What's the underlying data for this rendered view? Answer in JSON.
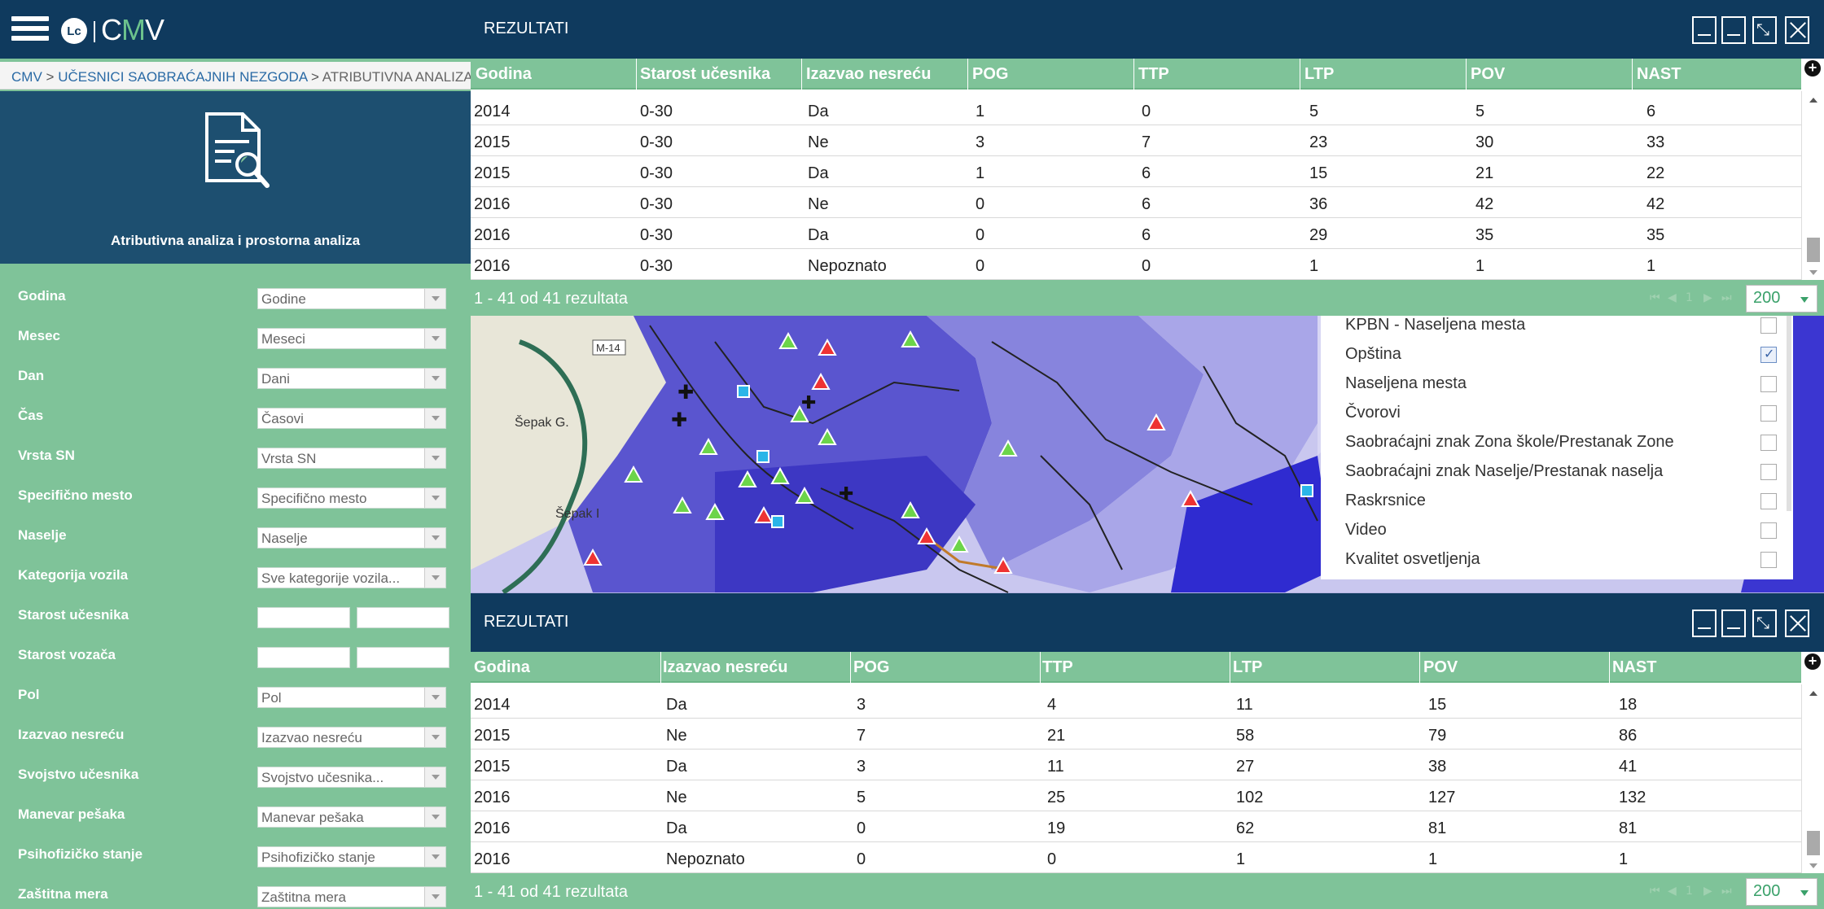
{
  "sidebar": {
    "logo_short": "Lc",
    "logo_text_pre": "C",
    "logo_text_m": "M",
    "logo_text_post": "V",
    "breadcrumb": [
      "CMV",
      "UČESNICI SAOBRAĆAJNIH NEZGODA",
      "ATRIBUTIVNA ANALIZA I P"
    ],
    "breadcrumb_sep": ">",
    "title": "Atributivna analiza i prostorna analiza",
    "filters": [
      {
        "label": "Godina",
        "value": "Godine"
      },
      {
        "label": "Mesec",
        "value": "Meseci"
      },
      {
        "label": "Dan",
        "value": "Dani"
      },
      {
        "label": "Čas",
        "value": "Časovi"
      },
      {
        "label": "Vrsta SN",
        "value": "Vrsta SN"
      },
      {
        "label": "Specifično mesto",
        "value": "Specifično mesto"
      },
      {
        "label": "Naselje",
        "value": "Naselje"
      },
      {
        "label": "Kategorija vozila",
        "value": "Sve kategorije vozila..."
      },
      {
        "label": "Starost učesnika",
        "value": ""
      },
      {
        "label": "Starost vozača",
        "value": ""
      },
      {
        "label": "Pol",
        "value": "Pol"
      },
      {
        "label": "Izazvao nesreću",
        "value": "Izazvao nesreću"
      },
      {
        "label": "Svojstvo učesnika",
        "value": "Svojstvo učesnika..."
      },
      {
        "label": "Manevar pešaka",
        "value": "Manevar pešaka"
      },
      {
        "label": "Psihofizičko stanje",
        "value": "Psihofizičko stanje"
      },
      {
        "label": "Zaštitna mera",
        "value": "Zaštitna mera"
      }
    ]
  },
  "panel1": {
    "title": "REZULTATI",
    "columns": [
      "Godina",
      "Starost učesnika",
      "Izazvao nesreću",
      "POG",
      "TTP",
      "LTP",
      "POV",
      "NAST"
    ],
    "rows": [
      [
        "2014",
        "0-30",
        "Da",
        "1",
        "0",
        "5",
        "5",
        "6"
      ],
      [
        "2015",
        "0-30",
        "Ne",
        "3",
        "7",
        "23",
        "30",
        "33"
      ],
      [
        "2015",
        "0-30",
        "Da",
        "1",
        "6",
        "15",
        "21",
        "22"
      ],
      [
        "2016",
        "0-30",
        "Ne",
        "0",
        "6",
        "36",
        "42",
        "42"
      ],
      [
        "2016",
        "0-30",
        "Da",
        "0",
        "6",
        "29",
        "35",
        "35"
      ],
      [
        "2016",
        "0-30",
        "Nepoznato",
        "0",
        "0",
        "1",
        "1",
        "1"
      ]
    ],
    "count_text": "1 - 41 od 41 rezultata",
    "page_size": "200"
  },
  "panel2": {
    "title": "REZULTATI",
    "columns": [
      "Godina",
      "Izazvao nesreću",
      "POG",
      "TTP",
      "LTP",
      "POV",
      "NAST"
    ],
    "rows": [
      [
        "2014",
        "Da",
        "3",
        "4",
        "11",
        "15",
        "18"
      ],
      [
        "2015",
        "Ne",
        "7",
        "21",
        "58",
        "79",
        "86"
      ],
      [
        "2015",
        "Da",
        "3",
        "11",
        "27",
        "38",
        "41"
      ],
      [
        "2016",
        "Ne",
        "5",
        "25",
        "102",
        "127",
        "132"
      ],
      [
        "2016",
        "Da",
        "0",
        "19",
        "62",
        "81",
        "81"
      ],
      [
        "2016",
        "Nepoznato",
        "0",
        "0",
        "1",
        "1",
        "1"
      ]
    ],
    "count_text": "1 - 41 od 41 rezultata",
    "page_size": "200"
  },
  "layers": [
    {
      "name": "KPBN - Naseljena mesta",
      "checked": false
    },
    {
      "name": "Opština",
      "checked": true
    },
    {
      "name": "Naseljena mesta",
      "checked": false
    },
    {
      "name": "Čvorovi",
      "checked": false
    },
    {
      "name": "Saobraćajni znak Zona škole/Prestanak Zone",
      "checked": false
    },
    {
      "name": "Saobraćajni znak Naselje/Prestanak naselja",
      "checked": false
    },
    {
      "name": "Raskrsnice",
      "checked": false
    },
    {
      "name": "Video",
      "checked": false
    },
    {
      "name": "Kvalitet osvetljenja",
      "checked": false
    }
  ],
  "map": {
    "road_label": "M-14",
    "place_labels": [
      "Šepak G.",
      "Šepak I"
    ]
  },
  "colors": {
    "header_navy": "#0f3a5e",
    "accent_green": "#7fc399",
    "map_purple": "#7b78d8"
  }
}
